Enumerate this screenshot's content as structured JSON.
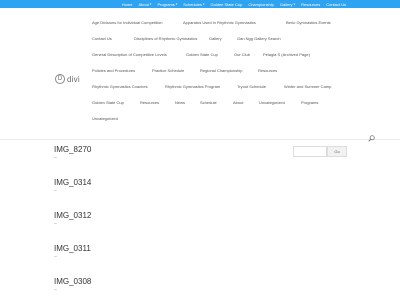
{
  "top_nav": {
    "items": [
      {
        "label": "Home",
        "has_caret": false
      },
      {
        "label": "About",
        "has_caret": true
      },
      {
        "label": "Programs",
        "has_caret": true
      },
      {
        "label": "Schedules",
        "has_caret": true
      },
      {
        "label": "Golden State Cup",
        "has_caret": false
      },
      {
        "label": "Championship",
        "has_caret": false
      },
      {
        "label": "Gallery",
        "has_caret": true
      },
      {
        "label": "Resources",
        "has_caret": false
      },
      {
        "label": "Contact Us",
        "has_caret": false
      }
    ]
  },
  "logo": {
    "mark": "D",
    "word": "divi"
  },
  "main_nav": {
    "rows": [
      [
        "Age Divisions for Individual Competition",
        "Apparatus Used in Rhythmic Gymnastics",
        "Berlo Gymnastics Events"
      ],
      [
        "Contact Us",
        "Disciplines of Rhythmic Gymnastics",
        "Gallery",
        "Gan Ngg Gallery Search"
      ],
      [
        "General Description of Competitive Levels",
        "Golden State Cup",
        "Our Club",
        "Pelagia S (Archived Page)"
      ],
      [
        "Policies and Procedures",
        "Practice Schedule",
        "Regional Championship",
        "Resources"
      ],
      [
        "Rhythmic Gymnastics Coaches",
        "Rhythmic Gymnastics Program",
        "Tryout Schedule",
        "Winter and Summer Camp"
      ],
      [
        "Golden State Cup",
        "Resources",
        "News",
        "Schedule",
        "About",
        "Uncategorized",
        "Programs"
      ],
      [
        "Uncategorized"
      ]
    ]
  },
  "posts": [
    {
      "title": "IMG_8270",
      "meta": "–"
    },
    {
      "title": "IMG_0314",
      "meta": "–"
    },
    {
      "title": "IMG_0312",
      "meta": "–"
    },
    {
      "title": "IMG_0311",
      "meta": "–"
    },
    {
      "title": "IMG_0308",
      "meta": "–"
    }
  ],
  "sidebar_search": {
    "placeholder": "",
    "button_label": "Go"
  },
  "colors": {
    "accent": "#2ea3f2"
  }
}
